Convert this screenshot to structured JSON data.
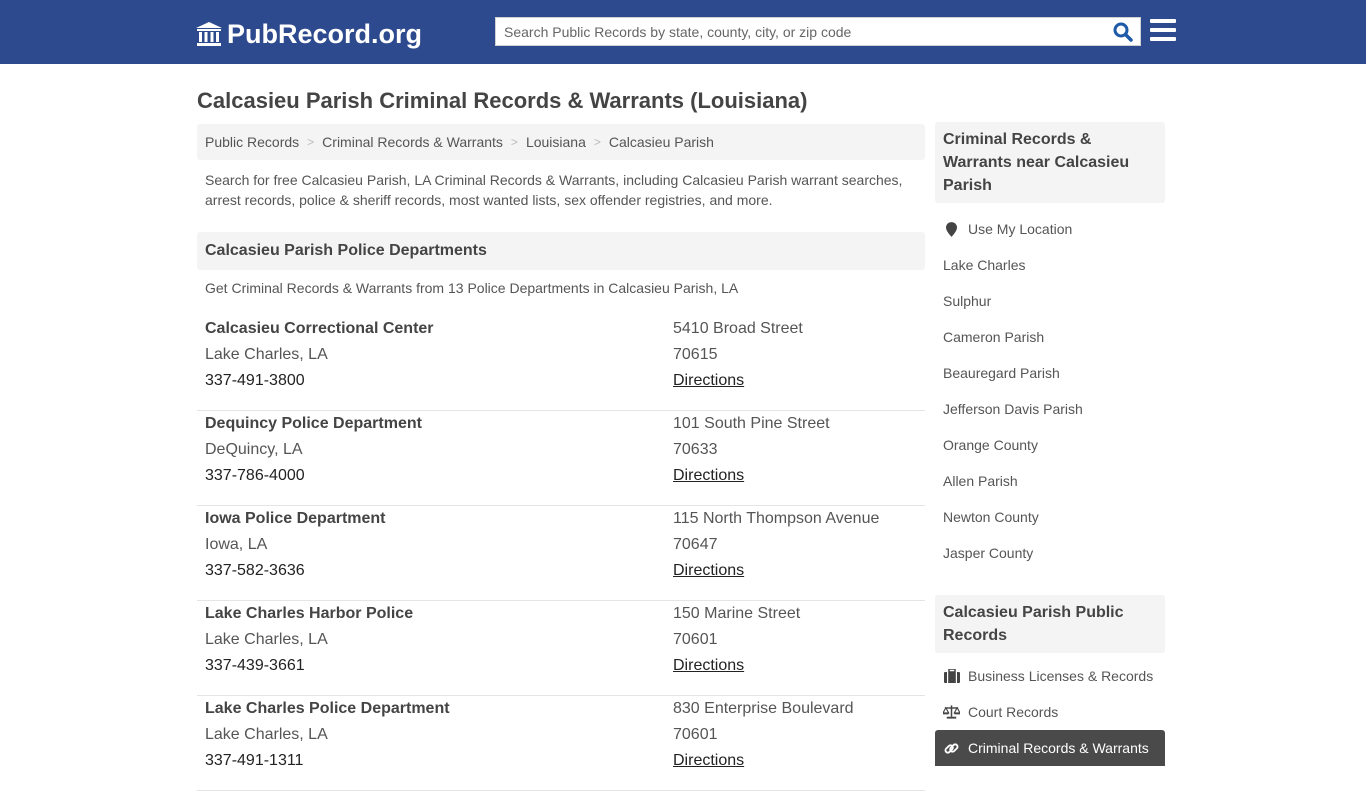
{
  "header": {
    "logo_text": "PubRecord.org",
    "logo_icon": "courthouse-icon",
    "search_placeholder": "Search Public Records by state, county, city, or zip code",
    "search_icon": "search-icon",
    "menu_icon": "hamburger-menu-icon",
    "brand_color": "#2e4a8e",
    "search_icon_color": "#1e5aa8"
  },
  "page": {
    "title": "Calcasieu Parish Criminal Records & Warrants (Louisiana)",
    "breadcrumb": [
      {
        "label": "Public Records"
      },
      {
        "label": "Criminal Records & Warrants"
      },
      {
        "label": "Louisiana"
      },
      {
        "label": "Calcasieu Parish"
      }
    ],
    "breadcrumb_separator": ">",
    "intro": "Search for free Calcasieu Parish, LA Criminal Records & Warrants, including Calcasieu Parish warrant searches, arrest records, police & sheriff records, most wanted lists, sex offender registries, and more."
  },
  "departments": {
    "heading": "Calcasieu Parish Police Departments",
    "subheading": "Get Criminal Records & Warrants from 13 Police Departments in Calcasieu Parish, LA",
    "items": [
      {
        "name": "Calcasieu Correctional Center",
        "city": "Lake Charles, LA",
        "phone": "337-491-3800",
        "street": "5410 Broad Street",
        "zip": "70615",
        "link": "Directions"
      },
      {
        "name": "Dequincy Police Department",
        "city": "DeQuincy, LA",
        "phone": "337-786-4000",
        "street": "101 South Pine Street",
        "zip": "70633",
        "link": "Directions"
      },
      {
        "name": "Iowa Police Department",
        "city": "Iowa, LA",
        "phone": "337-582-3636",
        "street": "115 North Thompson Avenue",
        "zip": "70647",
        "link": "Directions"
      },
      {
        "name": "Lake Charles Harbor Police",
        "city": "Lake Charles, LA",
        "phone": "337-439-3661",
        "street": "150 Marine Street",
        "zip": "70601",
        "link": "Directions"
      },
      {
        "name": "Lake Charles Police Department",
        "city": "Lake Charles, LA",
        "phone": "337-491-1311",
        "street": "830 Enterprise Boulevard",
        "zip": "70601",
        "link": "Directions"
      }
    ]
  },
  "sidebar": {
    "nearby": {
      "heading": "Criminal Records & Warrants near Calcasieu Parish",
      "location_item": {
        "label": "Use My Location",
        "icon": "map-marker-icon"
      },
      "items": [
        {
          "label": "Lake Charles"
        },
        {
          "label": "Sulphur"
        },
        {
          "label": "Cameron Parish"
        },
        {
          "label": "Beauregard Parish"
        },
        {
          "label": "Jefferson Davis Parish"
        },
        {
          "label": "Orange County"
        },
        {
          "label": "Allen Parish"
        },
        {
          "label": "Newton County"
        },
        {
          "label": "Jasper County"
        }
      ]
    },
    "public_records": {
      "heading": "Calcasieu Parish Public Records",
      "items": [
        {
          "label": "Business Licenses & Records",
          "icon": "briefcase-icon",
          "active": false
        },
        {
          "label": "Court Records",
          "icon": "balance-scale-icon",
          "active": false
        },
        {
          "label": "Criminal Records & Warrants",
          "icon": "link-icon",
          "active": true
        }
      ]
    }
  }
}
